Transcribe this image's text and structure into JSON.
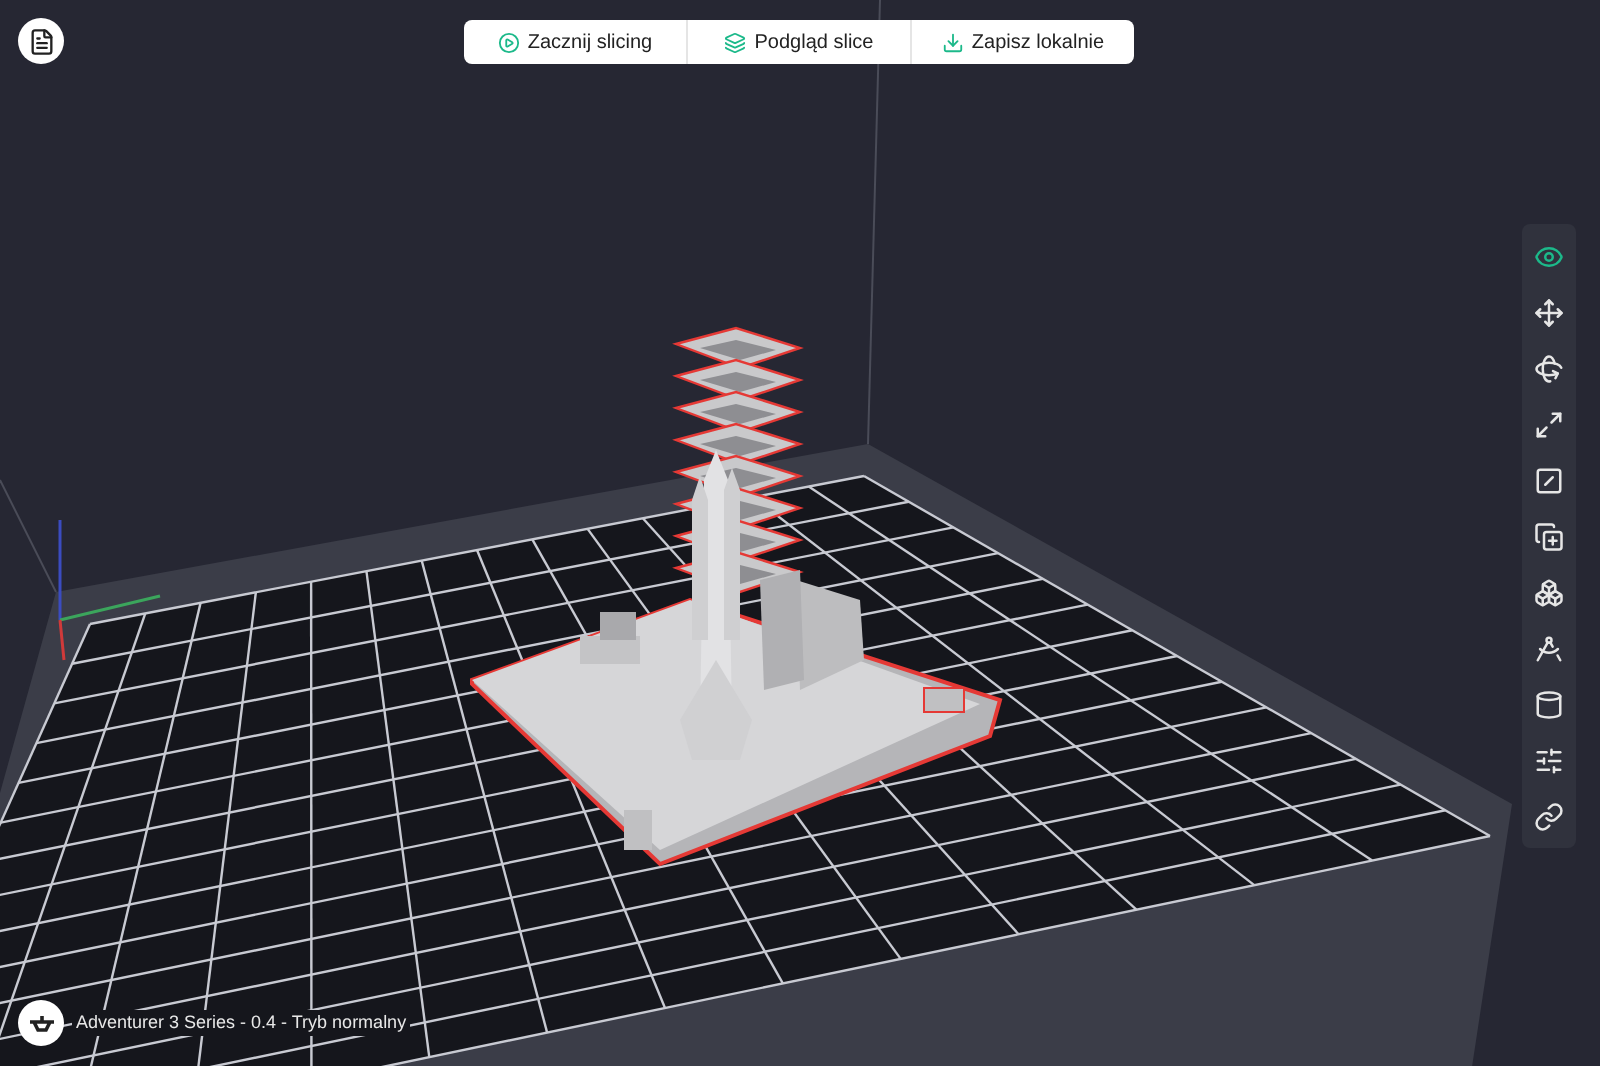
{
  "toolbar": {
    "buttons": [
      {
        "label": "Zacznij slicing"
      },
      {
        "label": "Podgląd slice"
      },
      {
        "label": "Zapisz lokalnie"
      }
    ]
  },
  "side_tools": [
    {
      "selected": true
    },
    {
      "selected": false
    },
    {
      "selected": false
    },
    {
      "selected": false
    },
    {
      "selected": false
    },
    {
      "selected": false
    },
    {
      "selected": false
    },
    {
      "selected": false
    },
    {
      "selected": false
    },
    {
      "selected": false
    },
    {
      "selected": false
    }
  ],
  "status_bar": {
    "printer": "Adventurer 3 Series - 0.4 - Tryb normalny"
  }
}
